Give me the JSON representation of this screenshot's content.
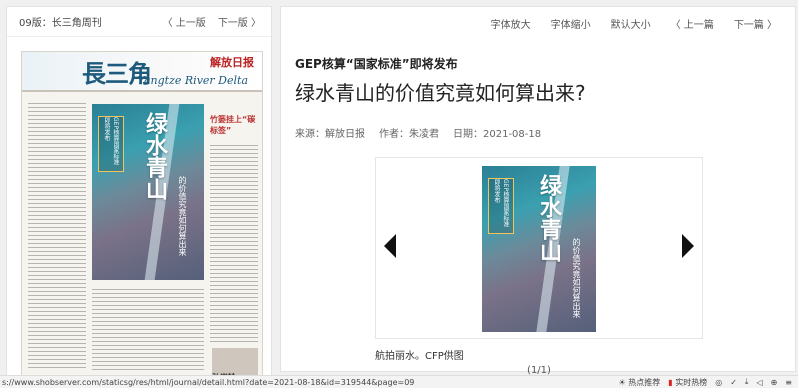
{
  "left_panel": {
    "edition": "09版：长三角周刊",
    "prev": "〈 上一版",
    "next": "下一版 〉"
  },
  "newspaper": {
    "masthead_title": "長三角",
    "masthead_brand": "解放日报",
    "masthead_en": "Yangtze River Delta",
    "cover_big_text": "绿水青山",
    "cover_box_text": "GEP核算国家标准即将发布",
    "cover_small_text": "的价值究竟如何算出来",
    "side_headline": "竹篓挂上“碳标签”",
    "author_name": "弘岩轮"
  },
  "toolbar": {
    "font_bigger": "字体放大",
    "font_smaller": "字体缩小",
    "font_default": "默认大小",
    "prev_article": "〈 上一篇",
    "next_article": "下一篇 〉"
  },
  "article": {
    "kicker": "GEP核算“国家标准”即将发布",
    "title": "绿水青山的价值究竟如何算出来?",
    "source": "来源：解放日报",
    "author": "作者：朱凌君",
    "date": "日期：2021-08-18",
    "caption": "航拍丽水。CFP供图",
    "counter": "(1/1)"
  },
  "status_bar": {
    "url": "s://www.shobserver.com/staticsg/res/html/journal/detail.html?date=2021-08-18&id=319544&page=09",
    "hot_recommend": "热点推荐",
    "hot_list": "实时热榜"
  }
}
